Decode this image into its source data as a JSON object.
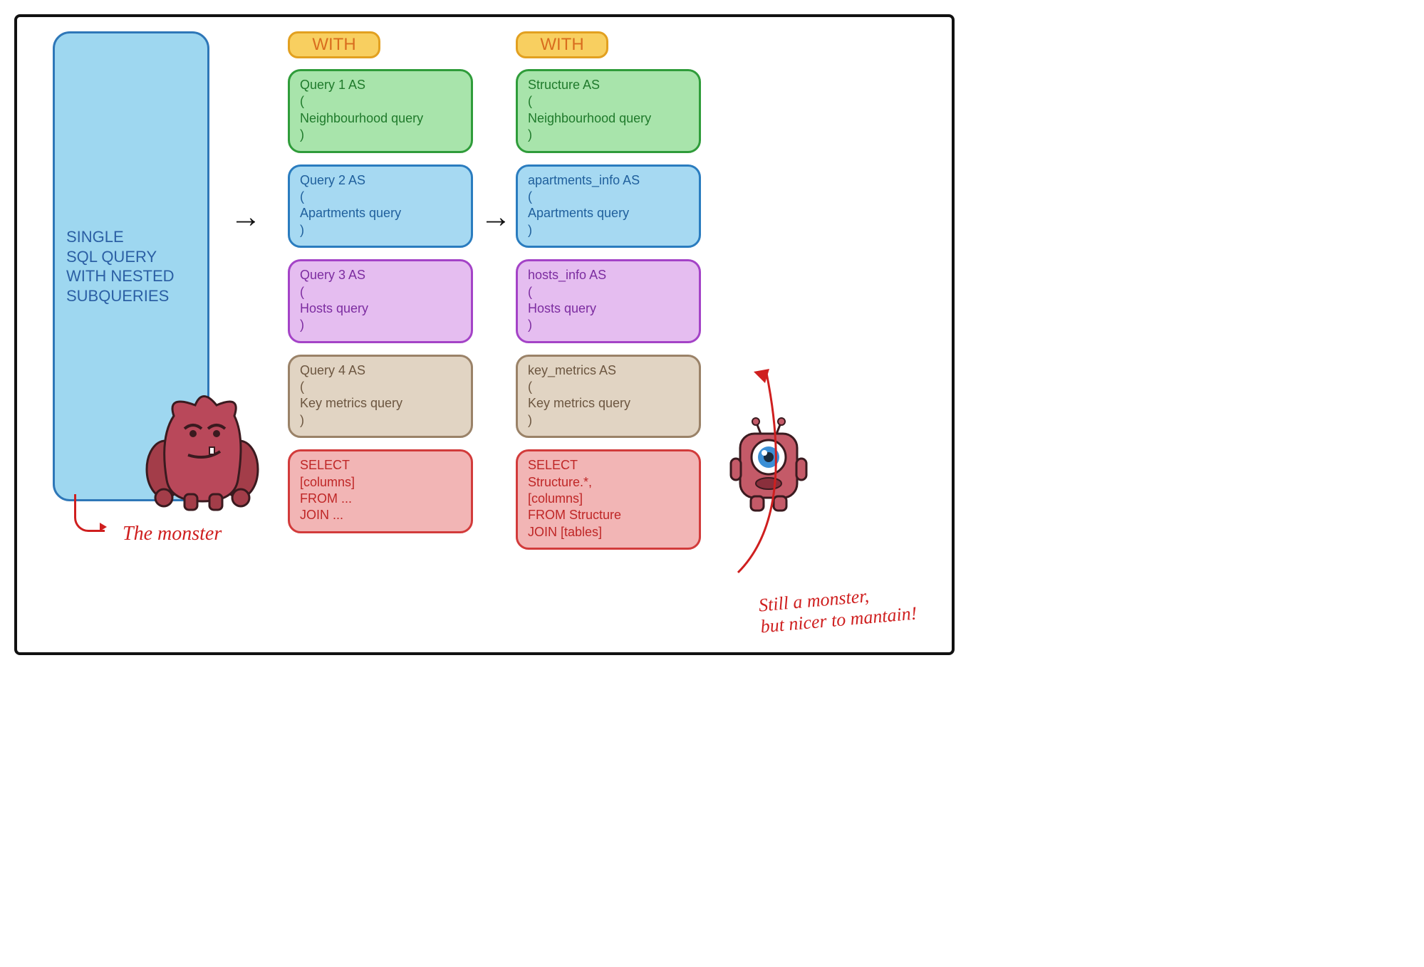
{
  "left_box": "SINGLE\nSQL QUERY\nWITH NESTED\nSUBQUERIES",
  "col2": {
    "with": "WITH",
    "b1": "Query 1 AS\n(\nNeighbourhood query\n)",
    "b2": "Query 2 AS\n(\nApartments query\n)",
    "b3": "Query 3 AS\n(\nHosts query\n)",
    "b4": "Query 4 AS\n(\nKey metrics query\n)",
    "b5": "SELECT\n    [columns]\nFROM ...\nJOIN ..."
  },
  "col3": {
    "with": "WITH",
    "b1": "Structure AS\n(\nNeighbourhood query\n)",
    "b2": "apartments_info AS\n(\nApartments query\n)",
    "b3": "hosts_info AS\n(\nHosts query\n)",
    "b4": "key_metrics AS\n(\nKey metrics query\n)",
    "b5": "SELECT\n    Structure.*,\n    [columns]\nFROM Structure\nJOIN [tables]"
  },
  "caption1": "The monster",
  "caption2": "Still a monster,\nbut nicer to mantain!"
}
